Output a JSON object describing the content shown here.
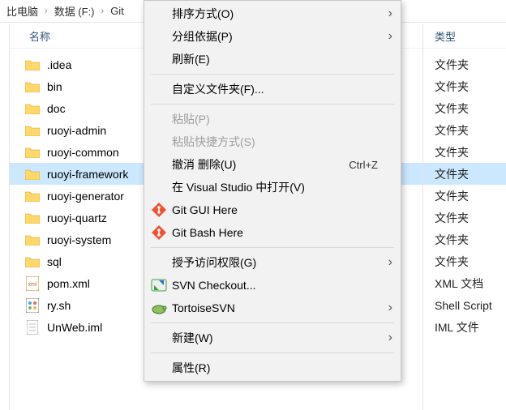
{
  "breadcrumb": {
    "item0": "比电脑",
    "item1": "数据 (F:)",
    "item2": "Git"
  },
  "columns": {
    "name_header": "名称",
    "type_header": "类型"
  },
  "files": [
    {
      "name": ".idea",
      "type": "文件夹",
      "icon": "folder",
      "selected": false
    },
    {
      "name": "bin",
      "type": "文件夹",
      "icon": "folder",
      "selected": false
    },
    {
      "name": "doc",
      "type": "文件夹",
      "icon": "folder",
      "selected": false
    },
    {
      "name": "ruoyi-admin",
      "type": "文件夹",
      "icon": "folder",
      "selected": false
    },
    {
      "name": "ruoyi-common",
      "type": "文件夹",
      "icon": "folder",
      "selected": false
    },
    {
      "name": "ruoyi-framework",
      "type": "文件夹",
      "icon": "folder",
      "selected": true
    },
    {
      "name": "ruoyi-generator",
      "type": "文件夹",
      "icon": "folder",
      "selected": false
    },
    {
      "name": "ruoyi-quartz",
      "type": "文件夹",
      "icon": "folder",
      "selected": false
    },
    {
      "name": "ruoyi-system",
      "type": "文件夹",
      "icon": "folder",
      "selected": false
    },
    {
      "name": "sql",
      "type": "文件夹",
      "icon": "folder",
      "selected": false
    },
    {
      "name": "pom.xml",
      "type": "XML 文档",
      "icon": "xml",
      "selected": false
    },
    {
      "name": "ry.sh",
      "type": "Shell Script",
      "icon": "sh",
      "selected": false
    },
    {
      "name": "UnWeb.iml",
      "type": "IML 文件",
      "icon": "file",
      "selected": false
    }
  ],
  "menu": [
    {
      "kind": "item",
      "label": "排序方式(O)",
      "submenu": true
    },
    {
      "kind": "item",
      "label": "分组依据(P)",
      "submenu": true
    },
    {
      "kind": "item",
      "label": "刷新(E)"
    },
    {
      "kind": "sep"
    },
    {
      "kind": "item",
      "label": "自定义文件夹(F)..."
    },
    {
      "kind": "sep"
    },
    {
      "kind": "item",
      "label": "粘贴(P)",
      "disabled": true
    },
    {
      "kind": "item",
      "label": "粘贴快捷方式(S)",
      "disabled": true
    },
    {
      "kind": "item",
      "label": "撤消 删除(U)",
      "shortcut": "Ctrl+Z"
    },
    {
      "kind": "item",
      "label": "在 Visual Studio 中打开(V)"
    },
    {
      "kind": "item",
      "label": "Git GUI Here",
      "icon": "git"
    },
    {
      "kind": "item",
      "label": "Git Bash Here",
      "icon": "git"
    },
    {
      "kind": "sep"
    },
    {
      "kind": "item",
      "label": "授予访问权限(G)",
      "submenu": true
    },
    {
      "kind": "item",
      "label": "SVN Checkout...",
      "icon": "svn"
    },
    {
      "kind": "item",
      "label": "TortoiseSVN",
      "icon": "tortoise",
      "submenu": true
    },
    {
      "kind": "sep"
    },
    {
      "kind": "item",
      "label": "新建(W)",
      "submenu": true
    },
    {
      "kind": "sep"
    },
    {
      "kind": "item",
      "label": "属性(R)"
    }
  ]
}
